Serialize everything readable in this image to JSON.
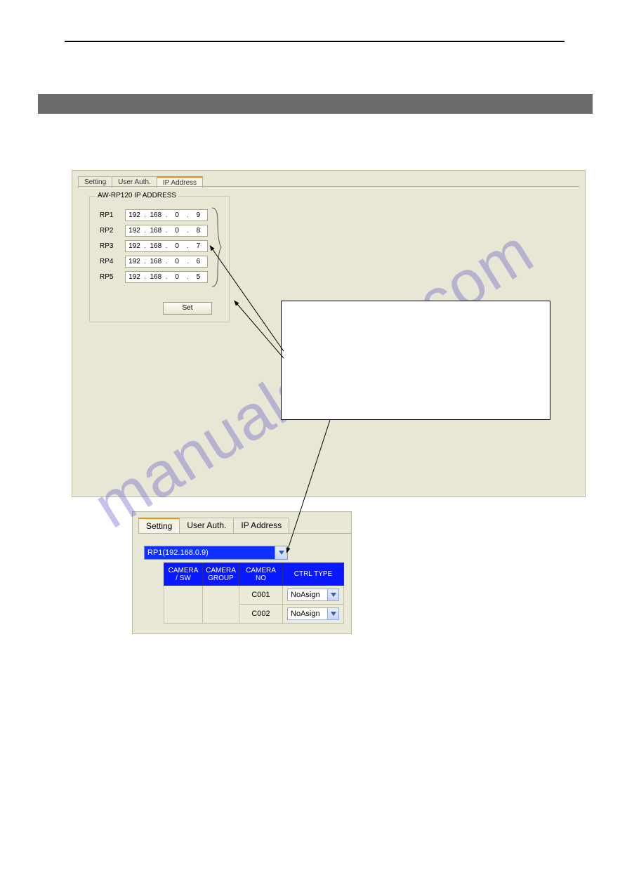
{
  "watermark": "manualshive.com",
  "shot1": {
    "tabs": [
      "Setting",
      "User Auth.",
      "IP Address"
    ],
    "active_tab": 2,
    "group_title": "AW-RP120 IP ADDRESS",
    "rows": [
      {
        "label": "RP1",
        "ip": [
          "192",
          "168",
          "0",
          "9"
        ]
      },
      {
        "label": "RP2",
        "ip": [
          "192",
          "168",
          "0",
          "8"
        ]
      },
      {
        "label": "RP3",
        "ip": [
          "192",
          "168",
          "0",
          "7"
        ]
      },
      {
        "label": "RP4",
        "ip": [
          "192",
          "168",
          "0",
          "6"
        ]
      },
      {
        "label": "RP5",
        "ip": [
          "192",
          "168",
          "0",
          "5"
        ]
      }
    ],
    "set_button": "Set"
  },
  "shot2": {
    "tabs": [
      "Setting",
      "User Auth.",
      "IP Address"
    ],
    "active_tab": 0,
    "combo_value": "RP1(192.168.0.9)",
    "headers": [
      "CAMERA / SW",
      "CAMERA GROUP",
      "CAMERA NO",
      "CTRL TYPE"
    ],
    "rows": [
      {
        "camera_no": "C001",
        "ctrl_type": "NoAsign"
      },
      {
        "camera_no": "C002",
        "ctrl_type": "NoAsign"
      }
    ]
  }
}
